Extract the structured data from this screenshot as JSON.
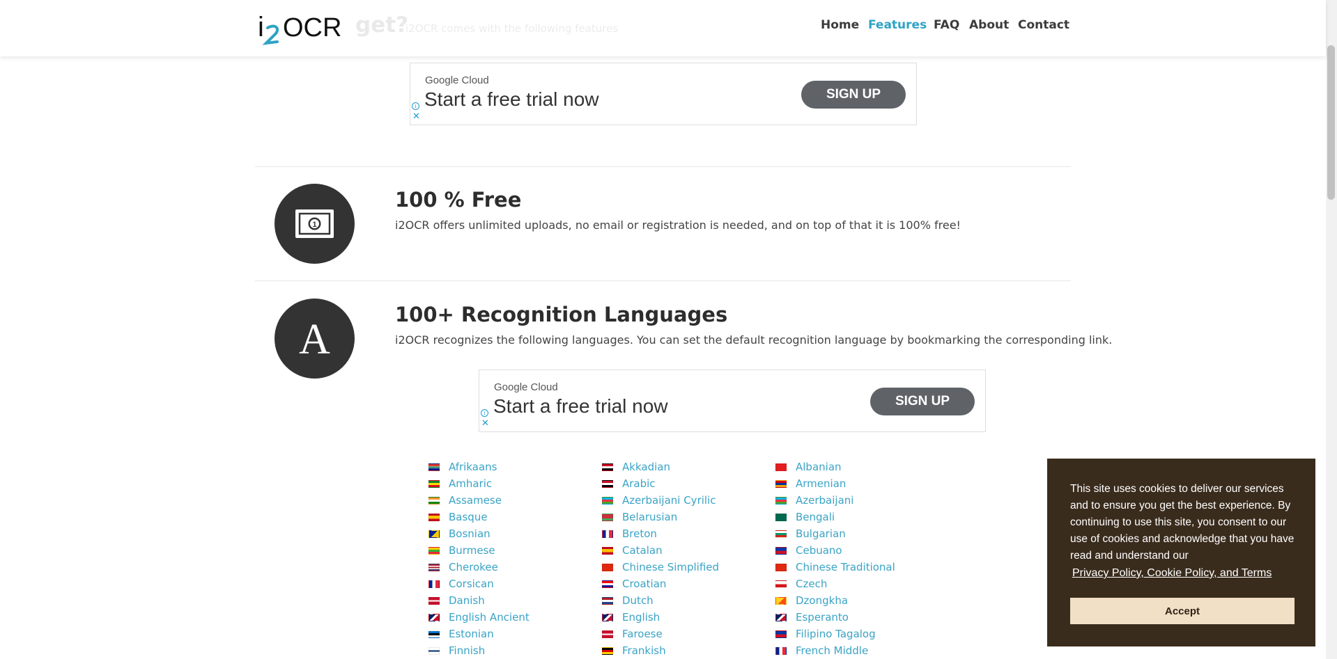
{
  "header": {
    "behind_title": "get?",
    "behind_subtitle": "i2OCR comes with the following features",
    "nav": [
      {
        "label": "Home",
        "active": false
      },
      {
        "label": "Features",
        "active": true
      },
      {
        "label": "FAQ",
        "active": false
      },
      {
        "label": "About",
        "active": false
      },
      {
        "label": "Contact",
        "active": false
      }
    ]
  },
  "logo": {
    "text_i": "i",
    "text_ocr": "OCR",
    "accent_color": "#2ea3c5"
  },
  "ads": [
    {
      "brand": "Google Cloud",
      "headline": "Start a free trial now",
      "button": "SIGN UP",
      "info": "i",
      "close": "✕"
    },
    {
      "brand": "Google Cloud",
      "headline": "Start a free trial now",
      "button": "SIGN UP",
      "info": "i",
      "close": "✕"
    }
  ],
  "features": [
    {
      "icon": "money-bill-icon",
      "title": "100 % Free",
      "description": "i2OCR offers unlimited uploads, no email or registration is needed, and on top of that it is 100% free!"
    },
    {
      "icon": "letter-a-icon",
      "icon_glyph": "A",
      "title": "100+ Recognition Languages",
      "description": "i2OCR recognizes the following languages. You can set the default recognition language by bookmarking the corresponding link."
    }
  ],
  "languages": {
    "columns": [
      [
        "Afrikaans",
        "Amharic",
        "Assamese",
        "Basque",
        "Bosnian",
        "Burmese",
        "Cherokee",
        "Corsican",
        "Danish",
        "English Ancient",
        "Estonian",
        "Finnish"
      ],
      [
        "Akkadian",
        "Arabic",
        "Azerbaijani Cyrilic",
        "Belarusian",
        "Breton",
        "Catalan",
        "Chinese Simplified",
        "Croatian",
        "Dutch",
        "English",
        "Faroese",
        "Frankish"
      ],
      [
        "Albanian",
        "Armenian",
        "Azerbaijani",
        "Bengali",
        "Bulgarian",
        "Cebuano",
        "Chinese Traditional",
        "Czech",
        "Dzongkha",
        "Esperanto",
        "Filipino Tagalog",
        "French Middle"
      ]
    ],
    "link_color": "#3aa3c6"
  },
  "cookie": {
    "text": "This site uses cookies to deliver our services and to ensure you get the best experience. By continuing to use this site, you consent to our use of cookies and acknowledge that you have read and understand our",
    "link": "Privacy Policy, Cookie Policy, and Terms",
    "button": "Accept",
    "background": "#3a2c1d",
    "button_color": "#f1dfc6"
  }
}
